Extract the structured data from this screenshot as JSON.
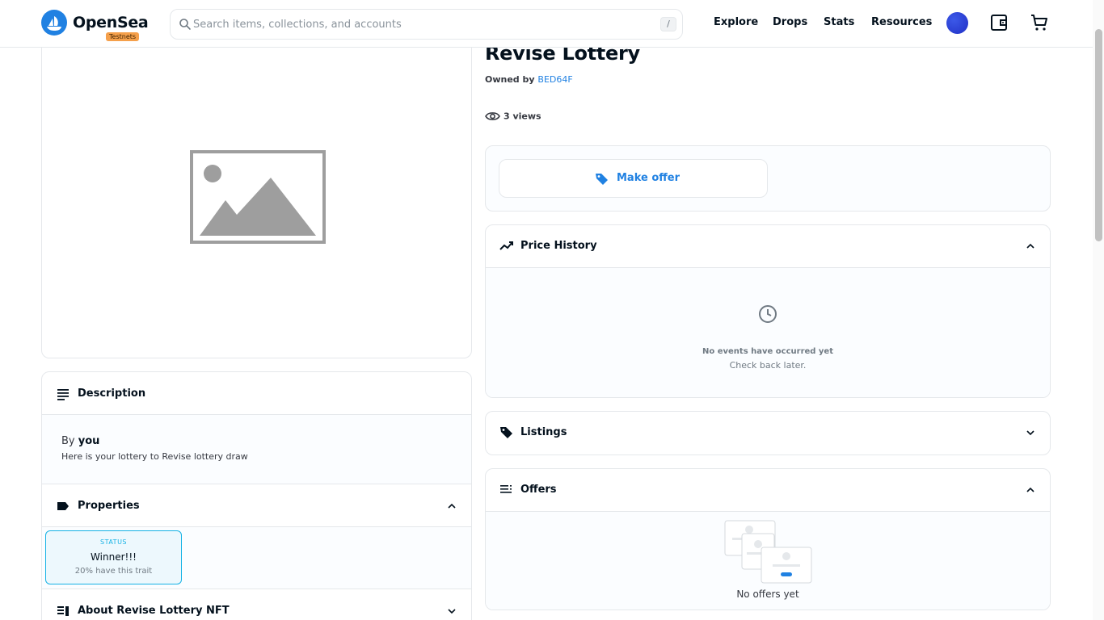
{
  "header": {
    "brand": "OpenSea",
    "badge": "Testnets",
    "search_placeholder": "Search items, collections, and accounts",
    "search_shortcut": "/",
    "nav": [
      "Explore",
      "Drops",
      "Stats",
      "Resources"
    ]
  },
  "item": {
    "title": "Revise Lottery",
    "owned_prefix": "Owned by",
    "owner": "BED64F",
    "views": "3 views",
    "make_offer": "Make offer"
  },
  "description": {
    "heading": "Description",
    "by_prefix": "By",
    "by_user": "you",
    "text": "Here is your lottery to Revise lottery draw"
  },
  "properties": {
    "heading": "Properties",
    "trait": {
      "type": "STATUS",
      "value": "Winner!!!",
      "rarity": "20% have this trait"
    }
  },
  "about": {
    "heading": "About Revise Lottery NFT"
  },
  "price_history": {
    "heading": "Price History",
    "empty_title": "No events have occurred yet",
    "empty_sub": "Check back later."
  },
  "listings": {
    "heading": "Listings"
  },
  "offers": {
    "heading": "Offers",
    "empty": "No offers yet"
  },
  "colors": {
    "accent": "#2081e2",
    "trait_border": "#15b2e5",
    "badge": "#f5a04b"
  },
  "icons": [
    "opensea-logo-icon",
    "search-icon",
    "avatar",
    "wallet-icon",
    "cart-icon",
    "image-placeholder-icon",
    "eye-icon",
    "tag-icon",
    "chart-line-icon",
    "clock-icon",
    "list-icon",
    "chevron-up-icon",
    "chevron-down-icon"
  ]
}
